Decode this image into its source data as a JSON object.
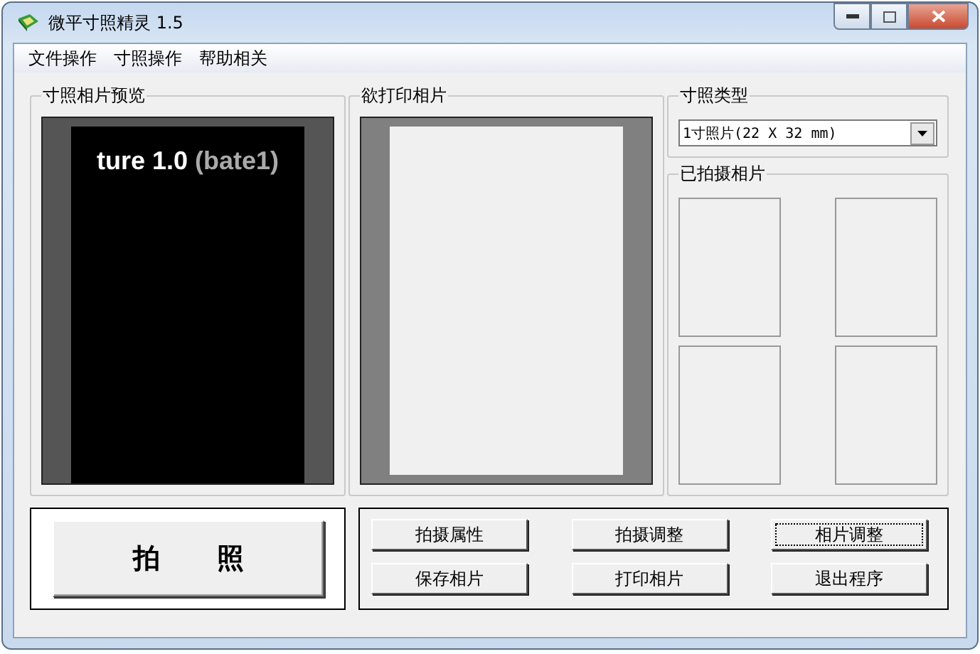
{
  "window": {
    "title": "微平寸照精灵 1.5"
  },
  "menu": [
    "文件操作",
    "寸照操作",
    "帮助相关"
  ],
  "preview": {
    "title": "寸照相片预览",
    "text_main": "ture 1.0",
    "text_sub": "(bate1)"
  },
  "print": {
    "title": "欲打印相片"
  },
  "photo_type": {
    "title": "寸照类型",
    "value": "1寸照片(22 X 32 mm)"
  },
  "taken": {
    "title": "已拍摄相片"
  },
  "shoot_button": "拍      照",
  "buttons": [
    {
      "label": "拍摄属性",
      "focused": false
    },
    {
      "label": "拍摄调整",
      "focused": false
    },
    {
      "label": "相片调整",
      "focused": true
    },
    {
      "label": "保存相片",
      "focused": false
    },
    {
      "label": "打印相片",
      "focused": false
    },
    {
      "label": "退出程序",
      "focused": false
    }
  ]
}
